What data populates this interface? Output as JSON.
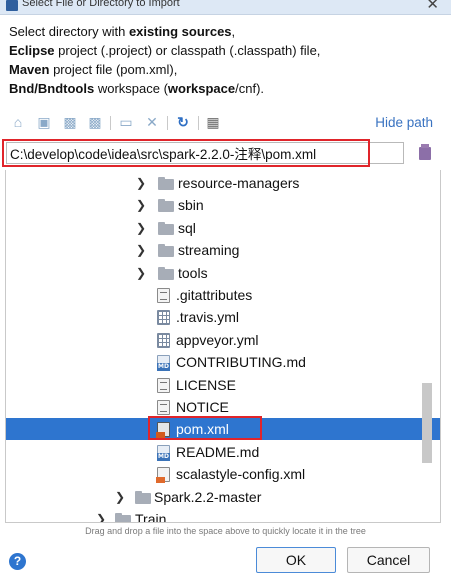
{
  "window": {
    "title": "Select File or Directory to Import",
    "close_glyph": "✕"
  },
  "description": {
    "line1_prefix": "Select directory with ",
    "line1_bold": "existing sources",
    "line1_suffix": ",",
    "line2_bold": "Eclipse",
    "line2_rest": " project (.project) or classpath (.classpath) file,",
    "line3_bold": "Maven",
    "line3_rest": " project file (pom.xml),",
    "line4_bold1": "Bnd/Bndtools",
    "line4_mid": " workspace (",
    "line4_bold2": "workspace",
    "line4_end": "/cnf)."
  },
  "toolbar": {
    "icons": [
      "home-icon",
      "desktop-icon",
      "project-icon",
      "module-icon",
      "new-folder-icon",
      "delete-icon",
      "refresh-icon",
      "show-hidden-icon"
    ],
    "hide_path_label": "Hide path"
  },
  "path": {
    "value": "C:\\develop\\code\\idea\\src\\spark-2.2.0-注释\\pom.xml"
  },
  "tree": {
    "items": [
      {
        "label": "resource-managers",
        "type": "folder",
        "expandable": true
      },
      {
        "label": "sbin",
        "type": "folder",
        "expandable": true
      },
      {
        "label": "sql",
        "type": "folder",
        "expandable": true
      },
      {
        "label": "streaming",
        "type": "folder",
        "expandable": true
      },
      {
        "label": "tools",
        "type": "folder",
        "expandable": true
      },
      {
        "label": ".gitattributes",
        "type": "text-file"
      },
      {
        "label": ".travis.yml",
        "type": "yml-file"
      },
      {
        "label": "appveyor.yml",
        "type": "yml-file"
      },
      {
        "label": "CONTRIBUTING.md",
        "type": "markdown-file"
      },
      {
        "label": "LICENSE",
        "type": "text-file"
      },
      {
        "label": "NOTICE",
        "type": "text-file"
      },
      {
        "label": "pom.xml",
        "type": "xml-file",
        "selected": true
      },
      {
        "label": "README.md",
        "type": "markdown-file"
      },
      {
        "label": "scalastyle-config.xml",
        "type": "xml-file"
      },
      {
        "label": "Spark.2.2-master",
        "type": "folder",
        "expandable": true
      },
      {
        "label": "Train",
        "type": "folder",
        "expandable": true
      }
    ]
  },
  "hint": "Drag and drop a file into the space above to quickly locate it in the tree",
  "buttons": {
    "help": "?",
    "ok": "OK",
    "cancel": "Cancel"
  },
  "colors": {
    "selection": "#2e75cf",
    "highlight_border": "#e0242a",
    "link": "#3a73c1"
  }
}
